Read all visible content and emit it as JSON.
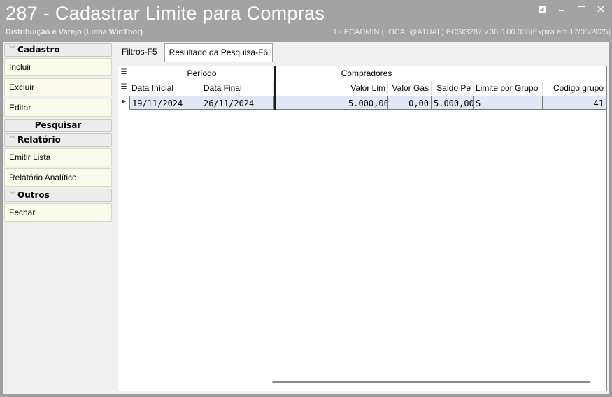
{
  "window": {
    "title": "287 - Cadastrar Limite para Compras",
    "subtitle": "Distribuição e Varejo (Linha WinThor)",
    "session": "1 - PCADMIN (LOCAL@ATUAL)   PCSIS287  v.36.0.00.008(Expira em 17/05/2025)",
    "restore_icon": "restore-icon",
    "minimize_icon": "minimize-icon",
    "maximize_icon": "maximize-icon",
    "close_icon": "×"
  },
  "sidebar": {
    "cadastro": {
      "label": "Cadastro",
      "items": [
        "Incluir",
        "Excluir",
        "Editar"
      ]
    },
    "pesquisar": {
      "label": "Pesquisar"
    },
    "relatorio": {
      "label": "Relatório",
      "items": [
        "Emitir Lista",
        "Relatório Analítico"
      ]
    },
    "outros": {
      "label": "Outros",
      "items": [
        "Fechar"
      ]
    }
  },
  "tabs": [
    "Filtros-F5",
    "Resultado da Pesquisa-F6"
  ],
  "grid": {
    "bands": {
      "periodo": "Período",
      "compradores": "Compradores"
    },
    "columns": [
      "Data Inícial",
      "Data Final",
      "Valor Lim",
      "Valor Gas",
      "Saldo Pe",
      "Limite por Grupo",
      "Codigo grupo"
    ],
    "rows": [
      [
        "19/11/2024",
        "26/11/2024",
        "5.000,00",
        "0,00",
        "5.000,00",
        "S",
        "41"
      ]
    ]
  }
}
